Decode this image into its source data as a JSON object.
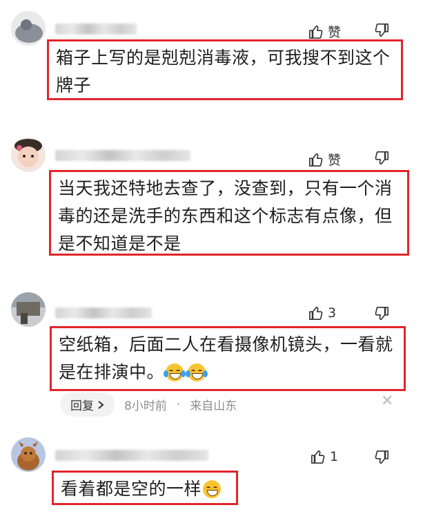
{
  "comments": [
    {
      "text": "箱子上写的是剋剋消毒液，可我搜不到这个牌子",
      "like_label": "赞",
      "emojis": 0
    },
    {
      "text": "当天我还特地去查了，没查到，只有一个消毒的还是洗手的东西和这个标志有点像，但是不知道是不是",
      "like_label": "赞",
      "emojis": 0
    },
    {
      "text": "空纸箱，后面二人在看摄像机镜头，一看就是在排演中。",
      "like_label": "3",
      "emojis": 2,
      "reply_label": "回复",
      "time": "8小时前",
      "location": "来自山东"
    },
    {
      "text": "看着都是空的一样",
      "like_label": "1",
      "emojis": 1
    }
  ],
  "icons": {
    "like": "thumbs-up-icon",
    "dislike": "thumbs-down-icon",
    "close": "close-icon",
    "reply_chevron": "chevron-right-icon"
  },
  "colors": {
    "highlight_border": "#e3242b",
    "meta_text": "#8d8d8d"
  }
}
